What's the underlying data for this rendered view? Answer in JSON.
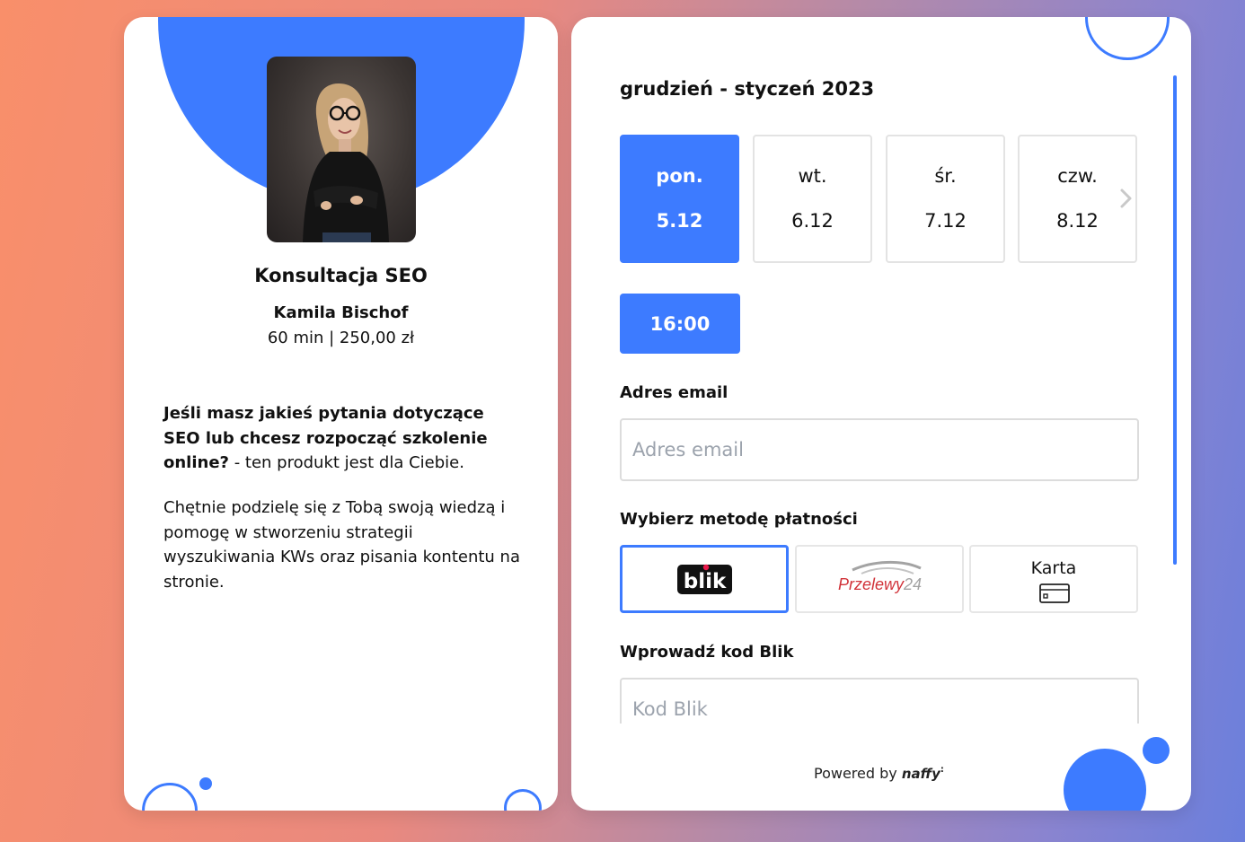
{
  "product": {
    "title": "Konsultacja SEO",
    "author": "Kamila Bischof",
    "meta": "60 min | 250,00 zł",
    "description_bold": "Jeśli masz jakieś pytania dotyczące SEO lub chcesz rozpocząć szkolenie online?",
    "description_rest": " - ten produkt jest dla Ciebie.",
    "description_2": "Chętnie podzielę się z Tobą swoją wiedzą i pomogę w stworzeniu strategii wyszukiwania KWs oraz pisania kontentu na stronie."
  },
  "calendar": {
    "month_label": "grudzień - styczeń 2023",
    "days": [
      {
        "name": "pon.",
        "date": "5.12",
        "selected": true
      },
      {
        "name": "wt.",
        "date": "6.12",
        "selected": false
      },
      {
        "name": "śr.",
        "date": "7.12",
        "selected": false
      },
      {
        "name": "czw.",
        "date": "8.12",
        "selected": false
      }
    ],
    "next_icon": "chevron-right-icon",
    "time_slot": "16:00"
  },
  "form": {
    "email_label": "Adres email",
    "email_placeholder": "Adres email",
    "email_value": "",
    "payment_label": "Wybierz metodę płatności",
    "payment_methods": [
      {
        "id": "blik",
        "label": "blik",
        "selected": true
      },
      {
        "id": "przelewy24",
        "label": "Przelewy24",
        "selected": false
      },
      {
        "id": "card",
        "label": "Karta",
        "selected": false,
        "icon": "credit-card-icon"
      }
    ],
    "blik_label": "Wprowadź kod Blik",
    "blik_placeholder": "Kod Blik"
  },
  "footer": {
    "powered_by": "Powered by",
    "brand": "naffy"
  },
  "colors": {
    "accent": "#3d7bff",
    "przelewy_red": "#d13239",
    "przelewy_gray": "#a3a3a3"
  }
}
